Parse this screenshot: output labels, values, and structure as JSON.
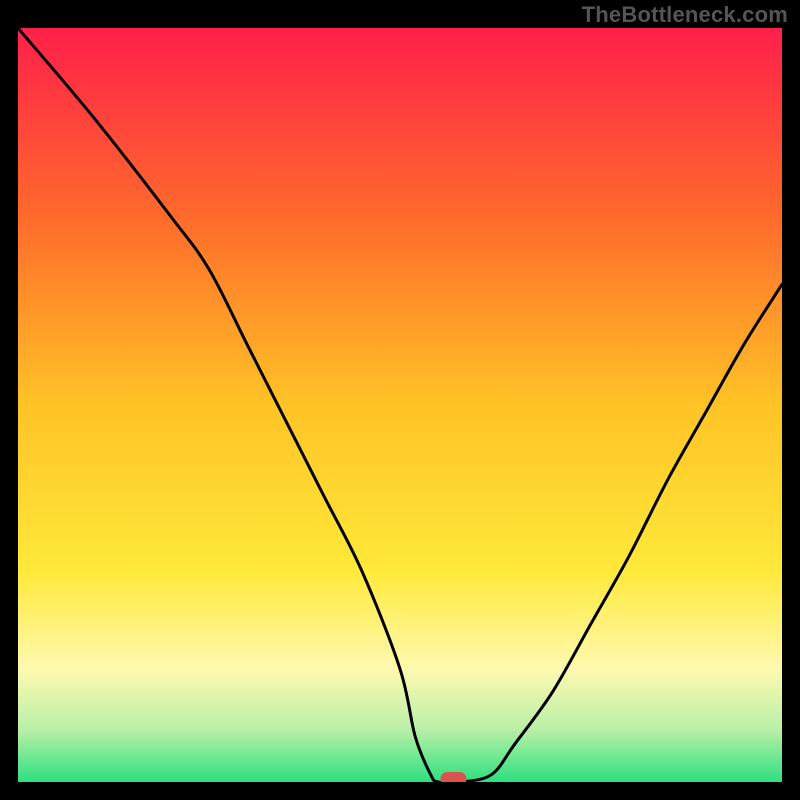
{
  "watermark": "TheBottleneck.com",
  "chart_data": {
    "type": "line",
    "title": "",
    "xlabel": "",
    "ylabel": "",
    "xlim": [
      0,
      100
    ],
    "ylim": [
      0,
      100
    ],
    "x": [
      0,
      10,
      20,
      25,
      30,
      35,
      40,
      45,
      50,
      52,
      54,
      55,
      58,
      62,
      65,
      70,
      75,
      80,
      85,
      90,
      95,
      100
    ],
    "y": [
      100,
      88,
      75,
      68,
      58,
      48,
      38,
      28,
      15,
      6,
      1,
      0,
      0,
      1,
      5,
      12,
      21,
      30,
      40,
      49,
      58,
      66
    ],
    "marker": {
      "x": 57,
      "y": 0,
      "color": "#d9534f"
    },
    "background_gradient": {
      "stops": [
        {
          "offset": 0.0,
          "color": "#ff1f4a"
        },
        {
          "offset": 0.25,
          "color": "#ff6a2c"
        },
        {
          "offset": 0.5,
          "color": "#ffc326"
        },
        {
          "offset": 0.72,
          "color": "#ffe93a"
        },
        {
          "offset": 0.85,
          "color": "#fff9b0"
        },
        {
          "offset": 0.93,
          "color": "#b9f0a8"
        },
        {
          "offset": 1.0,
          "color": "#2ee07e"
        }
      ]
    }
  }
}
